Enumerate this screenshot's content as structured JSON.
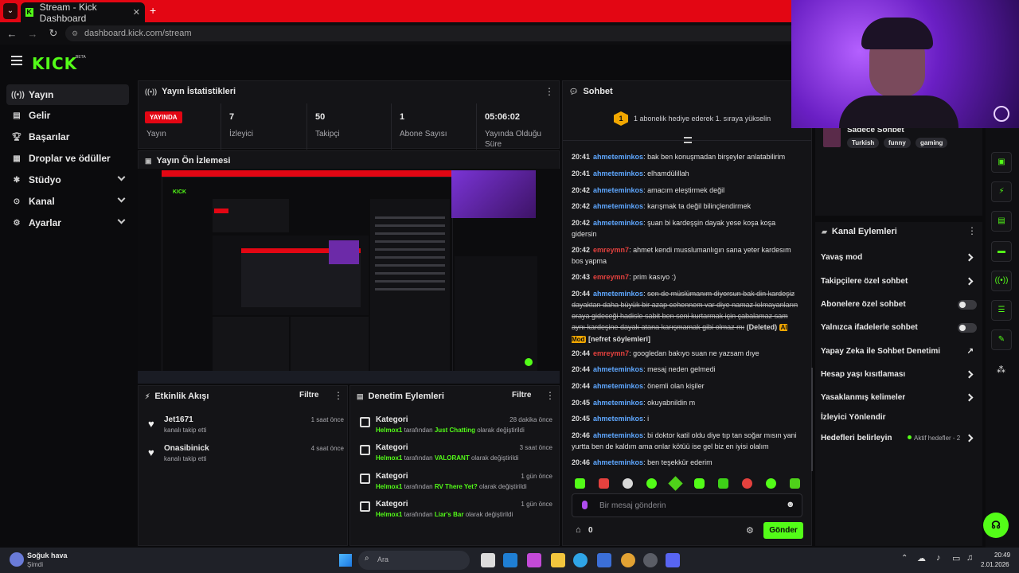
{
  "browser": {
    "tab_title": "Stream - Kick Dashboard",
    "url": "dashboard.kick.com/stream"
  },
  "brand": {
    "logo": "KICK",
    "beta": "BETA",
    "accent": "#53fc18"
  },
  "sidebar": {
    "items": [
      {
        "label": "Yayın",
        "icon": "broadcast-icon"
      },
      {
        "label": "Gelir",
        "icon": "revenue-icon"
      },
      {
        "label": "Başarılar",
        "icon": "trophy-icon"
      },
      {
        "label": "Droplar ve ödüller",
        "icon": "gift-icon"
      },
      {
        "label": "Stüdyo",
        "icon": "studio-icon"
      },
      {
        "label": "Kanal",
        "icon": "channel-icon"
      },
      {
        "label": "Ayarlar",
        "icon": "gear-icon"
      }
    ]
  },
  "stats": {
    "title": "Yayın İstatistikleri",
    "live_badge": "YAYINDA",
    "live_label": "Yayın",
    "viewers": {
      "value": "7",
      "label": "İzleyici"
    },
    "followers": {
      "value": "50",
      "label": "Takipçi"
    },
    "subs": {
      "value": "1",
      "label": "Abone Sayısı"
    },
    "uptime": {
      "value": "05:06:02",
      "label": "Yayında Olduğu Süre"
    }
  },
  "preview": {
    "title": "Yayın Ön İzlemesi"
  },
  "activity": {
    "title": "Etkinlik Akışı",
    "filter": "Filtre",
    "items": [
      {
        "name": "Jet1671",
        "desc": "kanalı takip etti",
        "time": "1 saat önce"
      },
      {
        "name": "Onasibinick",
        "desc": "kanalı takip etti",
        "time": "4 saat önce"
      }
    ]
  },
  "moderation": {
    "title": "Denetim Eylemleri",
    "filter": "Filtre",
    "items": [
      {
        "title": "Kategori",
        "who": "Helmox1",
        "mid": "tarafından",
        "cat": "Just Chatting",
        "end": "olarak değiştirildi",
        "time": "28 dakika önce"
      },
      {
        "title": "Kategori",
        "who": "Helmox1",
        "mid": "tarafından",
        "cat": "VALORANT",
        "end": "olarak değiştirildi",
        "time": "3 saat önce"
      },
      {
        "title": "Kategori",
        "who": "Helmox1",
        "mid": "tarafından",
        "cat": "RV There Yet?",
        "end": "olarak değiştirildi",
        "time": "1 gün önce"
      },
      {
        "title": "Kategori",
        "who": "Helmox1",
        "mid": "tarafından",
        "cat": "Liar's Bar",
        "end": "olarak değiştirildi",
        "time": "1 gün önce"
      }
    ]
  },
  "chat": {
    "title": "Sohbet",
    "gift_rank": "1",
    "gift_text": "1 abonelik hediye ederek 1. sıraya yükselin",
    "messages": [
      {
        "time": "20:41",
        "user": "ahmeteminkos",
        "color": "blue",
        "text": "bak ben konuşmadan birşeyler anlatabilirim"
      },
      {
        "time": "20:41",
        "user": "ahmeteminkos",
        "color": "blue",
        "text": "elhamdülillah"
      },
      {
        "time": "20:42",
        "user": "ahmeteminkos",
        "color": "blue",
        "text": "amacım eleştirmek değil"
      },
      {
        "time": "20:42",
        "user": "ahmeteminkos",
        "color": "blue",
        "text": "karışmak ta değil bilinçlendirmek"
      },
      {
        "time": "20:42",
        "user": "ahmeteminkos",
        "color": "blue",
        "text": "şuan bi kardeşşin dayak yese koşa koşa gidersin"
      },
      {
        "time": "20:42",
        "user": "emreymn7",
        "color": "red",
        "text": "ahmet kendi musslumanlıgın sana yeter kardesım bos yapma"
      },
      {
        "time": "20:43",
        "user": "emreymn7",
        "color": "red",
        "text": "prim kasıyo :)"
      },
      {
        "time": "20:44",
        "user": "ahmeteminkos",
        "color": "blue",
        "text": "sen de müslümanım diyorsun bak din kardeşiz dayaktan daha büyük bir azap cehennem var diye namaz kılmayanların oraya gideceği hadisle sabit ben seni kurtarmak için çabalamaz sam aynı kardeşine dayak atana karışmamak gibi olmaz mı",
        "deleted": true,
        "deleted_label": "(Deleted)",
        "ai_badge": "AI Mod",
        "reason": "[nefret söylemleri]"
      },
      {
        "time": "20:44",
        "user": "emreymn7",
        "color": "red",
        "text": "googledan bakıyo suan ne yazsam dıye"
      },
      {
        "time": "20:44",
        "user": "ahmeteminkos",
        "color": "blue",
        "text": "mesaj neden gelmedi"
      },
      {
        "time": "20:44",
        "user": "ahmeteminkos",
        "color": "blue",
        "text": "önemli olan kişiler"
      },
      {
        "time": "20:45",
        "user": "ahmeteminkos",
        "color": "blue",
        "text": "okuyabnildin m"
      },
      {
        "time": "20:45",
        "user": "ahmeteminkos",
        "color": "blue",
        "text": "i"
      },
      {
        "time": "20:46",
        "user": "ahmeteminkos",
        "color": "blue",
        "text": "bi doktor katil oldu diye tıp tan soğar mısın yani yurtta ben de kaldım ama onlar kötüü ise gel biz en iyisi olalım"
      },
      {
        "time": "20:46",
        "user": "ahmeteminkos",
        "color": "blue",
        "text": "ben teşekkür ederim"
      }
    ],
    "input_placeholder": "Bir mesaj gönderin",
    "points": "0",
    "send_label": "Gönder"
  },
  "stream_info": {
    "title": "Sadece Sohbet",
    "tags": [
      "Turkish",
      "funny",
      "gaming"
    ]
  },
  "channel_actions": {
    "title": "Kanal Eylemleri",
    "items": [
      {
        "label": "Yavaş mod",
        "control": "chevron"
      },
      {
        "label": "Takipçilere özel sohbet",
        "control": "chevron"
      },
      {
        "label": "Abonelere özel sohbet",
        "control": "toggle"
      },
      {
        "label": "Yalnızca ifadelerle sohbet",
        "control": "toggle"
      },
      {
        "label": "Yapay Zeka ile Sohbet Denetimi",
        "control": "external"
      },
      {
        "label": "Hesap yaşı kısıtlaması",
        "control": "chevron"
      },
      {
        "label": "Yasaklanmış kelimeler",
        "control": "chevron"
      },
      {
        "label": "İzleyici Yönlendir",
        "control": "none"
      },
      {
        "label": "Hedefleri belirleyin",
        "control": "chevron",
        "status": "Aktif hedefler - 2"
      }
    ]
  },
  "taskbar": {
    "weather_title": "Soğuk hava",
    "weather_sub": "Şimdi",
    "search_placeholder": "Ara",
    "time": "20:49",
    "date": "2.01.2026"
  }
}
